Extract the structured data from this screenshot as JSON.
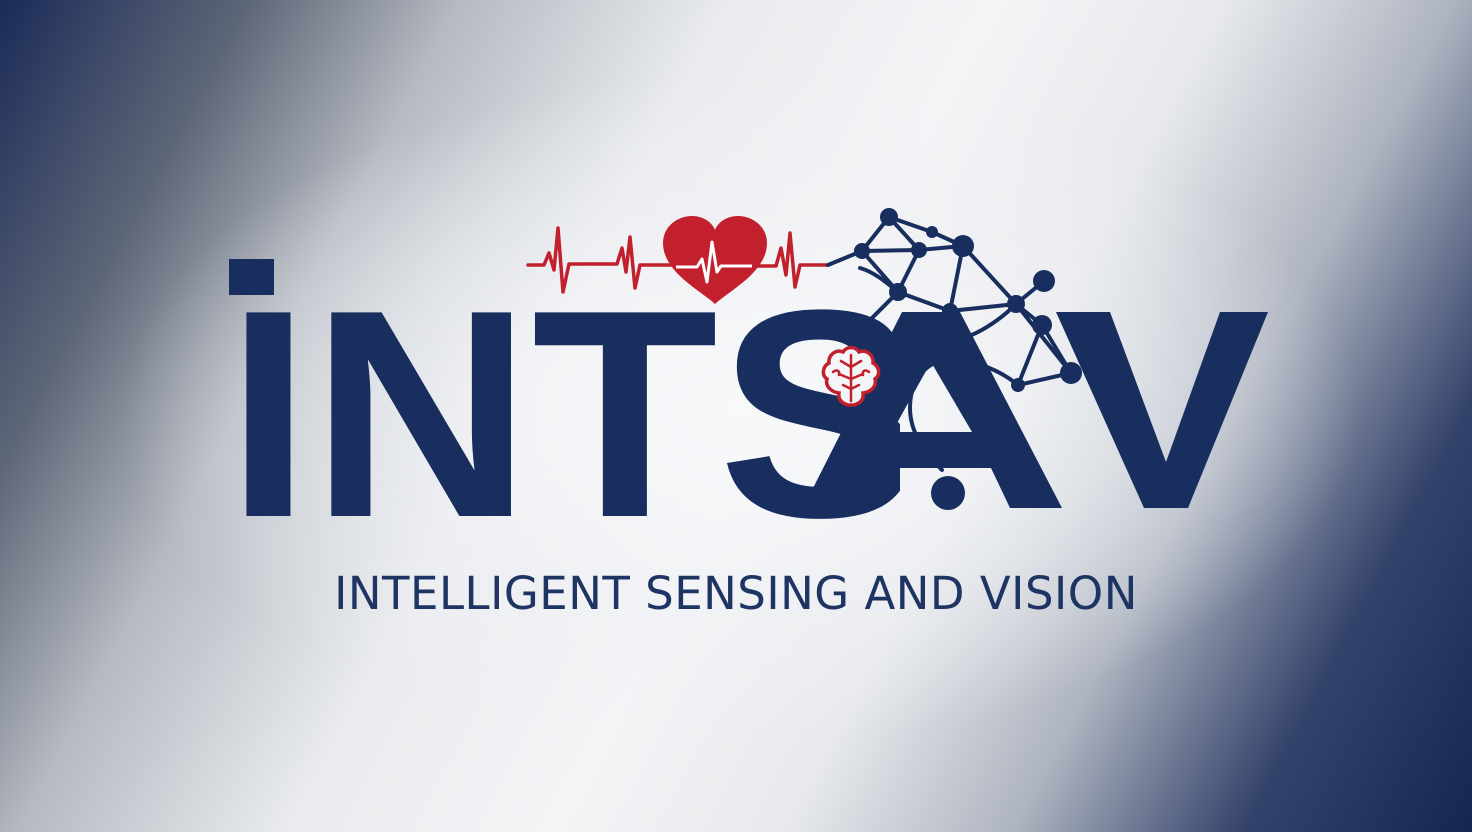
{
  "logo": {
    "wordmark": "INTSAV",
    "tagline": "INTELLIGENT SENSING AND VISION"
  },
  "colors": {
    "navy": "#172e5e",
    "red": "#c2202c",
    "tagline": "#1e3463"
  },
  "icons": [
    "heartbeat-line-icon",
    "heart-icon",
    "neural-network-icon",
    "brain-icon"
  ]
}
